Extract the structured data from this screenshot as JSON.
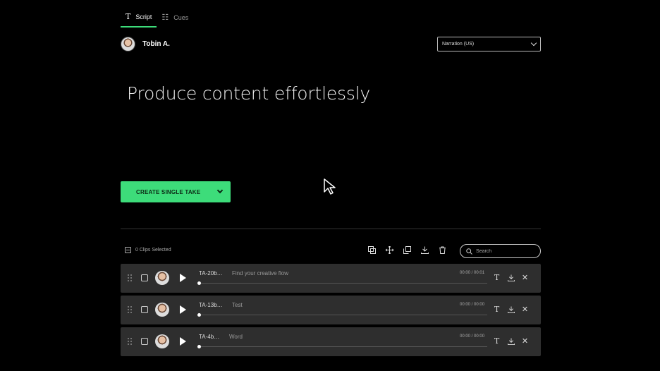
{
  "tabs": [
    {
      "label": "Script",
      "glyph": "T",
      "active": true
    },
    {
      "label": "Cues",
      "glyph": "☷",
      "active": false
    }
  ],
  "user": {
    "name": "Tobin A."
  },
  "voice_select": {
    "value": "Narration (US)"
  },
  "script": {
    "text": "Produce content effortlessly"
  },
  "create_button": {
    "label": "CREATE SINGLE TAKE"
  },
  "clips": {
    "selected_label": "0 Clips Selected",
    "search_placeholder": "Search",
    "rows": [
      {
        "id": "TA-20b…",
        "text": "Find your creative flow",
        "time": "00:00 / 00:01"
      },
      {
        "id": "TA-13b…",
        "text": "Test",
        "time": "00:00 / 00:00"
      },
      {
        "id": "TA-4b…",
        "text": "Word",
        "time": "00:00 / 00:00"
      }
    ]
  },
  "colors": {
    "accent": "#3ddc7a",
    "row_bg": "#2e2e2e",
    "background": "#000000"
  },
  "icons": [
    "script-icon",
    "cues-icon",
    "chevron-down-icon",
    "duplicate-icon",
    "move-icon",
    "copy-icon",
    "download-icon",
    "trash-icon",
    "search-icon",
    "drag-handle-icon",
    "play-icon",
    "text-icon",
    "close-icon"
  ]
}
